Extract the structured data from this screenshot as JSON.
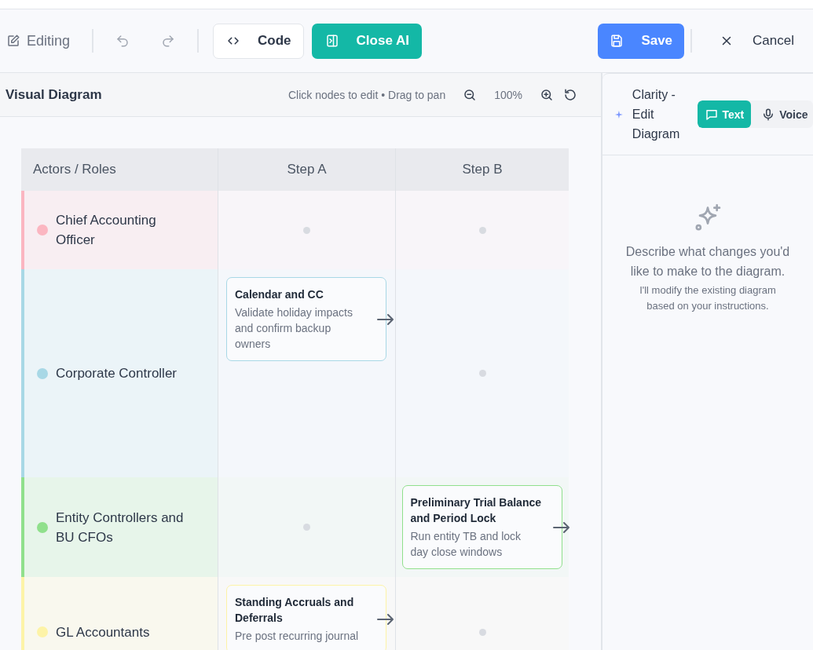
{
  "toolbar": {
    "status": "Editing",
    "undo": {
      "disabled": true
    },
    "redo": {
      "disabled": true
    },
    "buttons": [
      {
        "kind": "code",
        "label": "Code"
      },
      {
        "kind": "ai",
        "label": "Close AI"
      }
    ],
    "right_buttons": [
      {
        "kind": "save",
        "label": "Save"
      },
      {
        "kind": "cancel",
        "label": "Cancel"
      }
    ]
  },
  "diagram": {
    "title": "Visual Diagram",
    "hint": "Click nodes to edit • Drag to pan",
    "zoom": "100%",
    "columns": [
      "Actors / Roles",
      "Step A",
      "Step B"
    ],
    "lanes": [
      {
        "name": "Chief Accounting Officer",
        "color": "#fbb6c1",
        "cells": [
          {
            "kind": "empty"
          },
          {
            "kind": "empty"
          }
        ]
      },
      {
        "name": "Corporate Controller",
        "color": "#a8d8e6",
        "cells": [
          {
            "kind": "node",
            "title": "Calendar and CC",
            "description": "Validate holiday impacts and confirm backup owners",
            "arrow": true
          },
          {
            "kind": "empty"
          }
        ]
      },
      {
        "name": "Entity Controllers and BU CFOs",
        "color": "#90e08c",
        "cells": [
          {
            "kind": "empty"
          },
          {
            "kind": "node",
            "title": "Preliminary Trial Balance and Period Lock",
            "description": "Run entity TB and lock day close windows",
            "arrow": true
          }
        ]
      },
      {
        "name": "GL Accountants",
        "color": "#fdf3a7",
        "cells": [
          {
            "kind": "node",
            "title": "Standing Accruals and Deferrals",
            "description": "Pre post recurring journal",
            "arrow": true
          },
          {
            "kind": "empty"
          }
        ]
      }
    ]
  },
  "assistant": {
    "title": "Clarity - Edit Diagram",
    "modes": [
      {
        "kind": "text",
        "label": "Text",
        "selected": true
      },
      {
        "kind": "voice",
        "label": "Voice",
        "selected": false
      }
    ],
    "empty_title": "Describe what changes you'd like to make to the diagram.",
    "empty_hint": "I'll modify the existing diagram based on your instructions."
  }
}
